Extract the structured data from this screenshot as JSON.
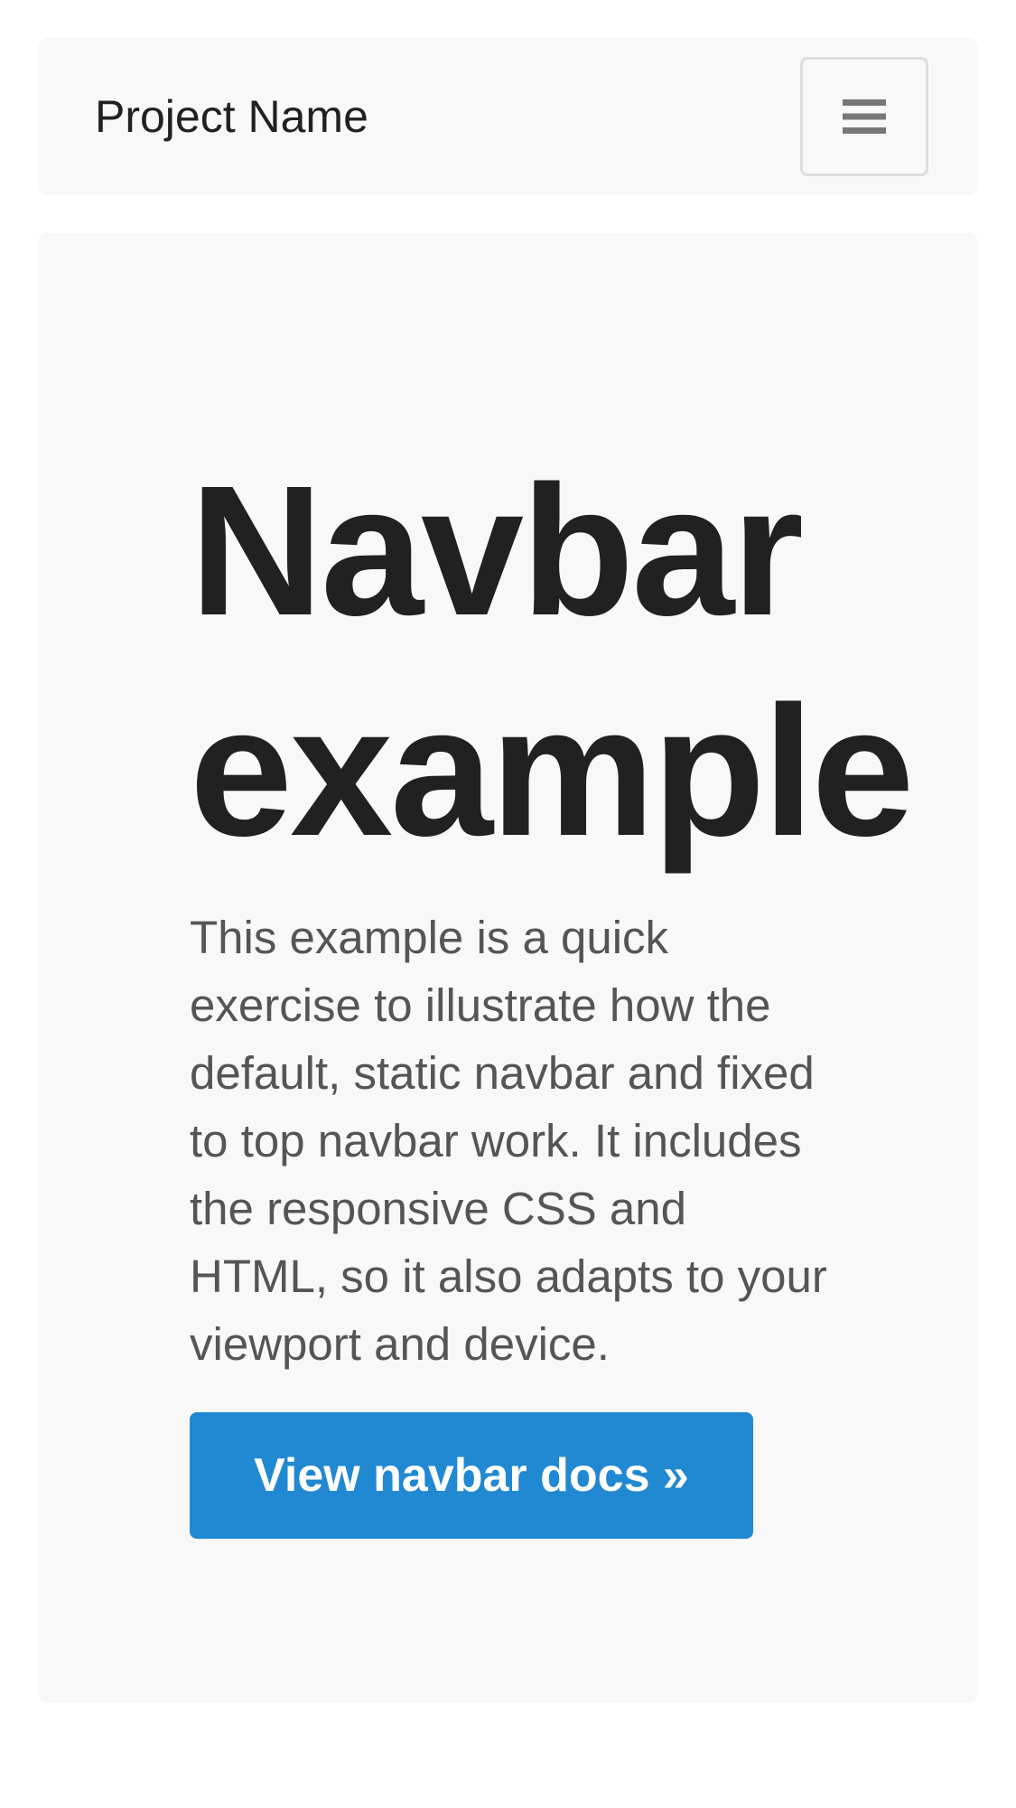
{
  "navbar": {
    "brand": "Project Name",
    "toggle_icon": "hamburger-menu-icon"
  },
  "jumbotron": {
    "title": "Navbar example",
    "text": "This example is a quick exercise to illustrate how the default, static navbar and fixed to top navbar work. It includes the responsive CSS and HTML, so it also adapts to your viewport and device.",
    "button_label": "View navbar docs »"
  },
  "colors": {
    "page_background": "#ffffff",
    "panel_background": "#f8f8f8",
    "primary_button": "#2188d2",
    "heading_text": "#212121",
    "body_text": "#555555",
    "toggle_icon": "#777777"
  }
}
